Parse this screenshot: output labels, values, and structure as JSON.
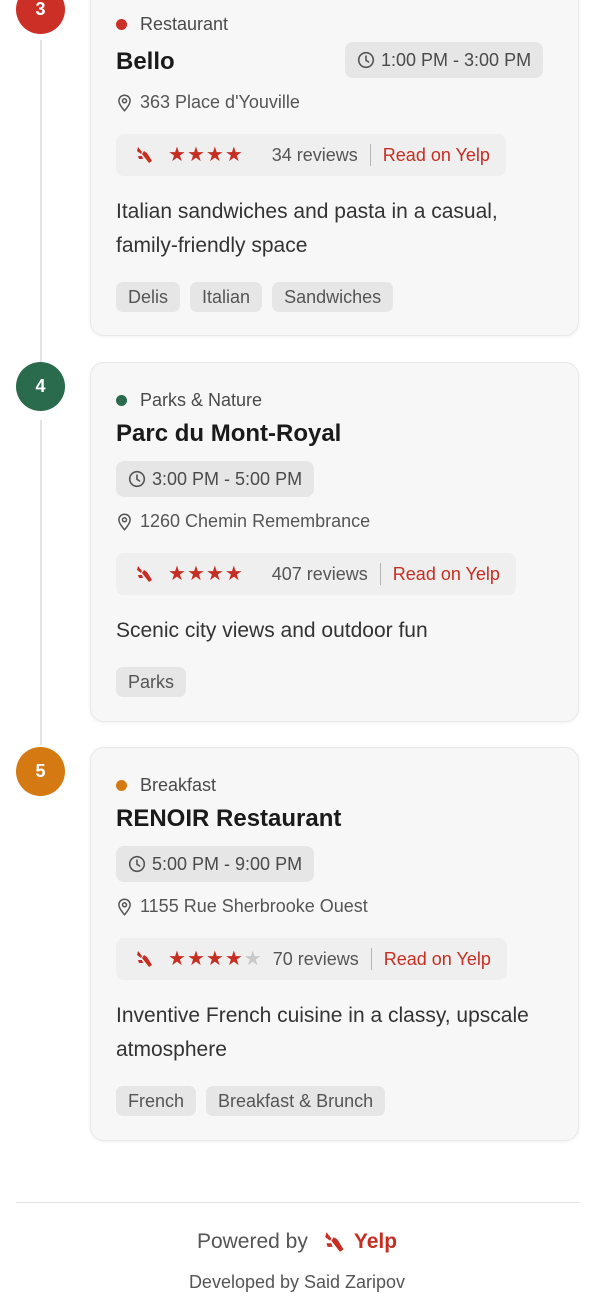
{
  "colors": {
    "restaurant": "#cc2f26",
    "parks": "#2a6a4d",
    "breakfast": "#d57a12",
    "yelp_red": "#c62e22"
  },
  "stops": [
    {
      "number": "3",
      "category": "Restaurant",
      "name": "Bello",
      "time": "1:00 PM - 3:00 PM",
      "address": "363 Place d'Youville",
      "rating": 4,
      "reviews": "34 reviews",
      "read_link": "Read on Yelp",
      "description": "Italian sandwiches and pasta in a casual, family-friendly space",
      "tags": [
        "Delis",
        "Italian",
        "Sandwiches"
      ]
    },
    {
      "number": "4",
      "category": "Parks & Nature",
      "name": "Parc du Mont-Royal",
      "time": "3:00 PM - 5:00 PM",
      "address": "1260 Chemin Remembrance",
      "rating": 4,
      "reviews": "407 reviews",
      "read_link": "Read on Yelp",
      "description": "Scenic city views and outdoor fun",
      "tags": [
        "Parks"
      ]
    },
    {
      "number": "5",
      "category": "Breakfast",
      "name": "RENOIR Restaurant",
      "time": "5:00 PM - 9:00 PM",
      "address": "1155 Rue Sherbrooke Ouest",
      "rating": 4,
      "reviews": "70 reviews",
      "read_link": "Read on Yelp",
      "description": "Inventive French cuisine in a classy, upscale atmosphere",
      "tags": [
        "French",
        "Breakfast & Brunch"
      ]
    }
  ],
  "footer": {
    "powered_by": "Powered by",
    "brand": "Yelp",
    "developed_by": "Developed by Said Zaripov"
  },
  "icons": [
    "clock-icon",
    "map-pin-icon",
    "yelp-burst-icon",
    "star-icon"
  ]
}
